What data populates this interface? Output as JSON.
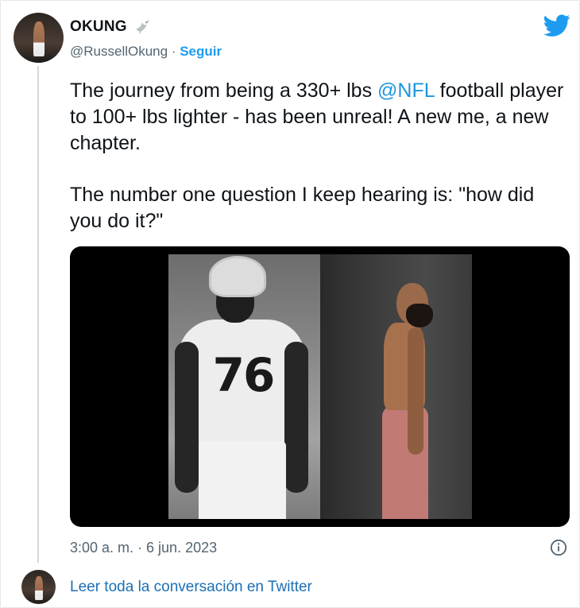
{
  "tweet": {
    "author_name": "OKUNG",
    "handle": "@RussellOkung",
    "separator": " · ",
    "follow_label": "Seguir",
    "text_p1_before": "The journey from being a 330+ lbs ",
    "text_p1_mention": "@NFL",
    "text_p1_after": " football player to 100+ lbs lighter - has been unreal! A new me, a new chapter.",
    "text_p2": "The number one question I keep hearing is: \"how did you do it?\"",
    "jersey_number": "76",
    "timestamp": "3:00 a. m. · 6 jun. 2023"
  },
  "footer": {
    "conversation_link": "Leer toda la conversación en Twitter"
  },
  "icons": {
    "brand": "twitter-bird-icon",
    "name_badge": "dove-icon",
    "info": "info-icon"
  },
  "colors": {
    "accent": "#1d9bf0",
    "mention": "#1b95e0",
    "secondary_text": "#536471",
    "thread_line": "#cfd9de"
  }
}
